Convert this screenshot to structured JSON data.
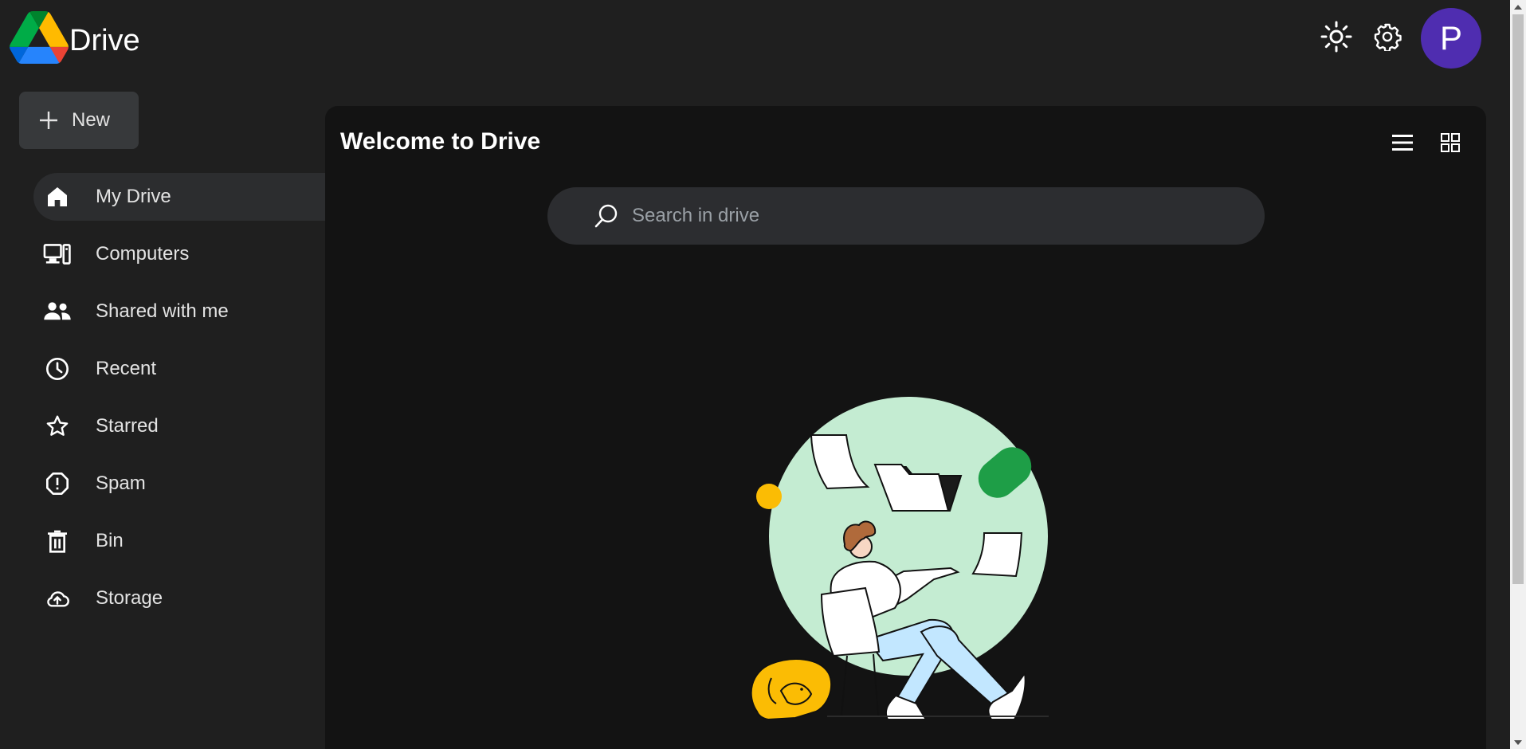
{
  "header": {
    "app_title": "Drive",
    "avatar_letter": "P",
    "theme_icon": "sun-icon",
    "settings_icon": "gear-icon"
  },
  "sidebar": {
    "new_label": "New",
    "items": [
      {
        "label": "My Drive",
        "icon": "home-icon",
        "active": true
      },
      {
        "label": "Computers",
        "icon": "computers-icon",
        "active": false
      },
      {
        "label": "Shared with me",
        "icon": "people-icon",
        "active": false
      },
      {
        "label": "Recent",
        "icon": "clock-icon",
        "active": false
      },
      {
        "label": "Starred",
        "icon": "star-icon",
        "active": false
      },
      {
        "label": "Spam",
        "icon": "spam-icon",
        "active": false
      },
      {
        "label": "Bin",
        "icon": "trash-icon",
        "active": false
      },
      {
        "label": "Storage",
        "icon": "cloud-icon",
        "active": false
      }
    ]
  },
  "main": {
    "title": "Welcome to Drive",
    "search_placeholder": "Search in drive"
  },
  "colors": {
    "background": "#1f1f1f",
    "panel": "#131313",
    "avatar": "#4f2db0",
    "active_nav": "#2c2d2f",
    "search_bg": "#2c2d30"
  }
}
